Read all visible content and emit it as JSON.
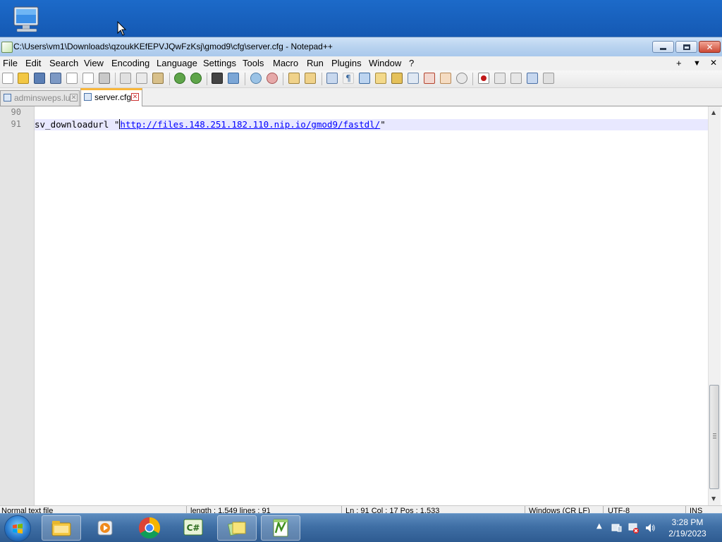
{
  "window": {
    "title": "C:\\Users\\vm1\\Downloads\\qzoukKEfEPVJQwFzKsj\\gmod9\\cfg\\server.cfg - Notepad++"
  },
  "menu": {
    "items": [
      "File",
      "Edit",
      "Search",
      "View",
      "Encoding",
      "Language",
      "Settings",
      "Tools",
      "Macro",
      "Run",
      "Plugins",
      "Window",
      "?"
    ],
    "right_plus": "+",
    "right_down": "▼",
    "right_close": "✕"
  },
  "tabs": [
    {
      "label": "adminsweps.lua",
      "active": false
    },
    {
      "label": "server.cfg",
      "active": true
    }
  ],
  "editor": {
    "lines": [
      {
        "number": "90",
        "text_before": "",
        "url": "",
        "text_after": ""
      },
      {
        "number": "91",
        "text_before": "sv_downloadurl \"",
        "url": "http://files.148.251.182.110.nip.io/gmod9/fastdl/",
        "text_after": "\""
      }
    ],
    "current_line_color": "#e8e8ff"
  },
  "status": {
    "file_type": "Normal text file",
    "length": "length : 1,549    lines : 91",
    "position": "Ln : 91    Col : 17    Pos : 1,533",
    "eol": "Windows (CR LF)",
    "encoding": "UTF-8",
    "mode": "INS"
  },
  "taskbar": {
    "clock_time": "3:28 PM",
    "clock_date": "2/19/2023",
    "apps": [
      "file-explorer-icon",
      "media-player-icon",
      "chrome-icon",
      "csharp-ide-icon",
      "sticky-notes-icon",
      "notepadpp-icon"
    ]
  },
  "colors": {
    "desktop": "#1a5fb4",
    "url": "#0000ff",
    "active_tab_accent": "#f9b73b"
  }
}
